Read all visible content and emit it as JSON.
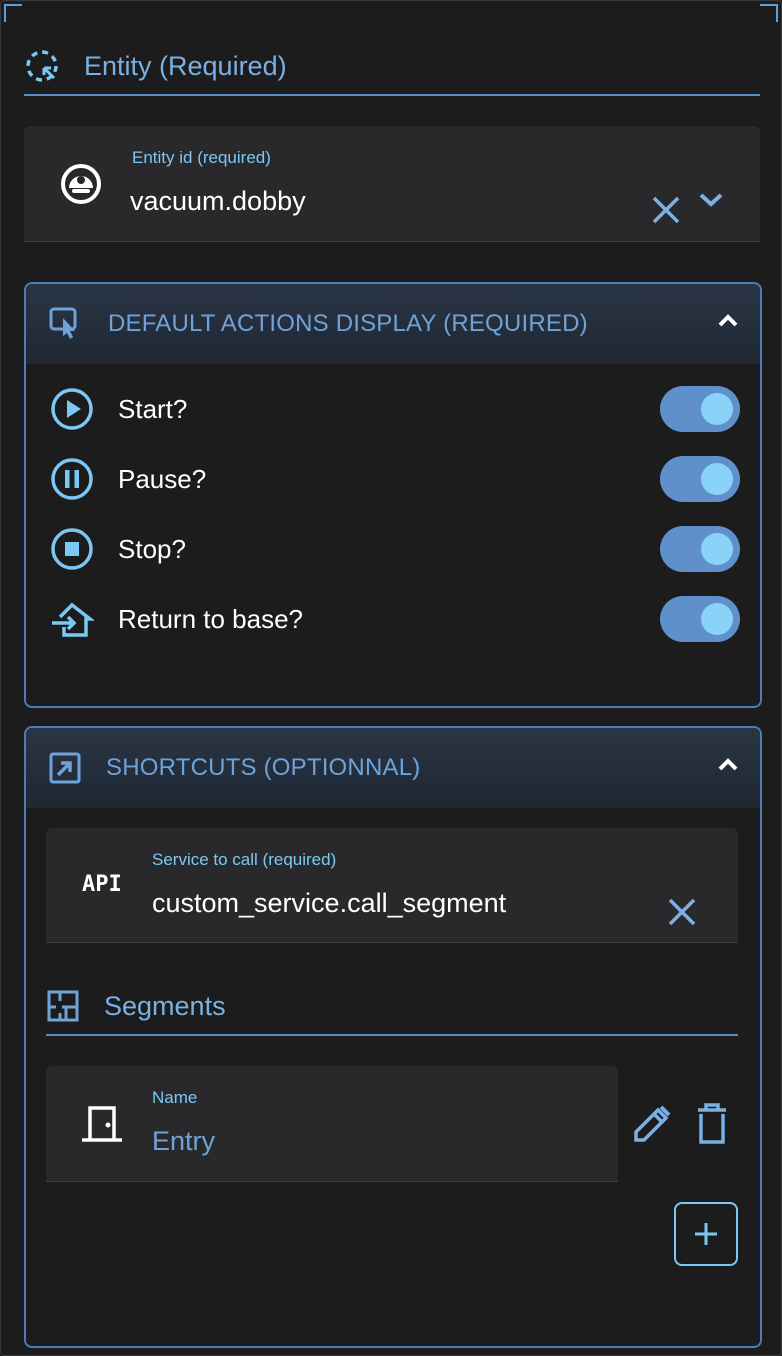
{
  "entity_section": {
    "title": "Entity (Required)",
    "field_label": "Entity id (required)",
    "field_value": "vacuum.dobby"
  },
  "actions_panel": {
    "title": "DEFAULT ACTIONS DISPLAY (REQUIRED)",
    "items": [
      {
        "label": "Start?",
        "icon": "play-circle-icon",
        "checked": true
      },
      {
        "label": "Pause?",
        "icon": "pause-circle-icon",
        "checked": true
      },
      {
        "label": "Stop?",
        "icon": "stop-circle-icon",
        "checked": true
      },
      {
        "label": "Return to base?",
        "icon": "home-import-icon",
        "checked": true
      }
    ]
  },
  "shortcuts_panel": {
    "title": "SHORTCUTS (OPTIONNAL)",
    "service_label": "Service to call (required)",
    "service_value": "custom_service.call_segment",
    "api_badge": "API",
    "segments_title": "Segments",
    "segment": {
      "name_label": "Name",
      "name_value": "Entry"
    }
  },
  "colors": {
    "accent": "#7ab0e3",
    "label": "#7cc8f5",
    "toggle_track": "#5f90cc",
    "toggle_knob": "#8ad3f8",
    "background": "#1c1c1d"
  }
}
